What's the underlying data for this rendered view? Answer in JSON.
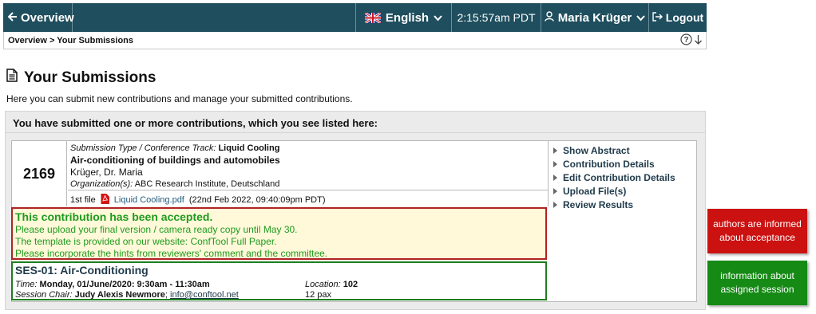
{
  "topbar": {
    "overview": "Overview",
    "language": "English",
    "time": "2:15:57am PDT",
    "user": "Maria Krüger",
    "logout": "Logout"
  },
  "breadcrumb": "Overview > Your Submissions",
  "page": {
    "title": "Your Submissions",
    "intro": "Here you can submit new contributions and manage your submitted contributions."
  },
  "panel": {
    "heading": "You have submitted one or more contributions, which you see listed here:"
  },
  "submission": {
    "number": "2169",
    "type_label": "Submission Type / Conference Track:",
    "type_value": "Liquid Cooling",
    "title": "Air-conditioning of buildings and automobiles",
    "authors": "Krüger, Dr. Maria",
    "org_label": "Organization(s):",
    "org_value": "ABC Research Institute, Deutschland",
    "file_label": "1st file",
    "file_name": "Liquid Cooling.pdf",
    "file_date": "(22nd Feb 2022, 09:40:09pm PDT)"
  },
  "actions": [
    "Show Abstract",
    "Contribution Details",
    "Edit Contribution Details",
    "Upload File(s)",
    "Review Results"
  ],
  "acceptance": {
    "title": "This contribution has been accepted.",
    "lines": [
      "Please upload your final version / camera ready copy until May 30.",
      "The template is provided on our website: ConfTool Full Paper.",
      "Please incorporate the hints from reviewers' comment and the committee."
    ]
  },
  "session": {
    "title": "SES-01: Air-Conditioning",
    "time_label": "Time:",
    "time_value": "Monday, 01/June/2020: 9:30am - 11:30am",
    "chair_label": "Session Chair:",
    "chair_name": "Judy Alexis Newmore",
    "chair_sep": ";",
    "chair_email": "info@conftool.net",
    "location_label": "Location:",
    "location_value": "102",
    "capacity": "12 pax"
  },
  "callouts": {
    "accepted": "authors are informed about acceptance",
    "session": "information about assigned session"
  },
  "colors": {
    "topbar": "#1f4e5e",
    "accepted_border": "#b22222",
    "accepted_text": "#1e9b1e",
    "session_border": "#1e7e1e",
    "callout_red": "#cc1111",
    "callout_green": "#158a15"
  }
}
